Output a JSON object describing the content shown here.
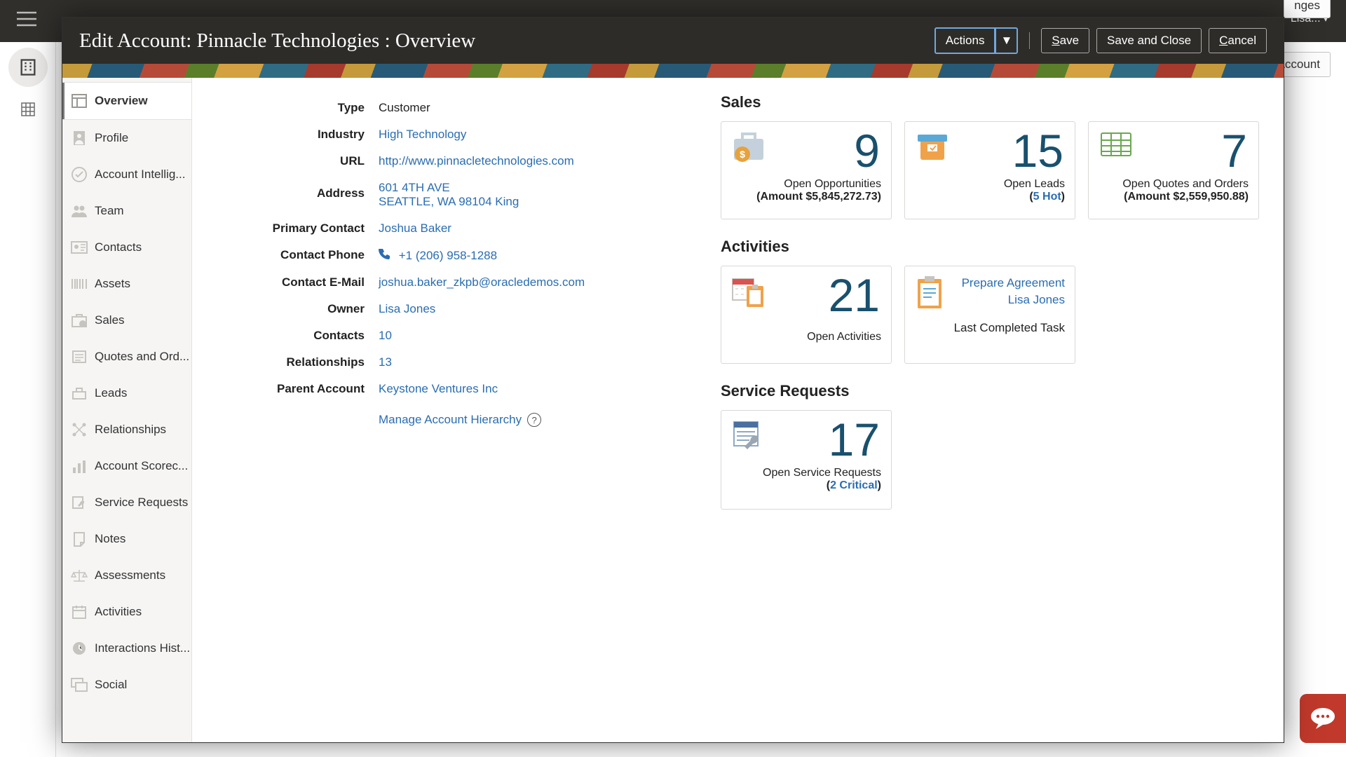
{
  "background": {
    "user_label": "Lisa...",
    "btn_account": "Account",
    "btn_nges": "nges"
  },
  "header": {
    "title": "Edit Account: Pinnacle Technologies : Overview",
    "actions": {
      "actions": "Actions",
      "save": "Save",
      "save_close": "Save and Close",
      "cancel": "Cancel",
      "save_u": "S",
      "save_rest": "ave",
      "cancel_u": "C",
      "cancel_rest": "ancel"
    }
  },
  "sidebar": {
    "items": [
      {
        "label": "Overview"
      },
      {
        "label": "Profile"
      },
      {
        "label": "Account Intellig..."
      },
      {
        "label": "Team"
      },
      {
        "label": "Contacts"
      },
      {
        "label": "Assets"
      },
      {
        "label": "Sales"
      },
      {
        "label": "Quotes and Ord..."
      },
      {
        "label": "Leads"
      },
      {
        "label": "Relationships"
      },
      {
        "label": "Account Scorec..."
      },
      {
        "label": "Service Requests"
      },
      {
        "label": "Notes"
      },
      {
        "label": "Assessments"
      },
      {
        "label": "Activities"
      },
      {
        "label": "Interactions Hist..."
      },
      {
        "label": "Social"
      }
    ]
  },
  "details": {
    "type": {
      "label": "Type",
      "value": "Customer"
    },
    "industry": {
      "label": "Industry",
      "value": "High Technology"
    },
    "url": {
      "label": "URL",
      "value": "http://www.pinnacletechnologies.com"
    },
    "address": {
      "label": "Address",
      "line1": "601 4TH AVE",
      "line2": "SEATTLE, WA 98104 King"
    },
    "primary_contact": {
      "label": "Primary Contact",
      "value": "Joshua Baker"
    },
    "contact_phone": {
      "label": "Contact Phone",
      "value": "+1 (206) 958-1288"
    },
    "contact_email": {
      "label": "Contact E-Mail",
      "value": "joshua.baker_zkpb@oracledemos.com"
    },
    "owner": {
      "label": "Owner",
      "value": "Lisa Jones"
    },
    "contacts": {
      "label": "Contacts",
      "value": "10"
    },
    "relationships": {
      "label": "Relationships",
      "value": "13"
    },
    "parent_account": {
      "label": "Parent Account",
      "value": "Keystone Ventures Inc"
    },
    "manage_hierarchy": "Manage Account Hierarchy"
  },
  "sales": {
    "title": "Sales",
    "open_opps": {
      "num": "9",
      "caption": "Open Opportunities",
      "sub": "(Amount $5,845,272.73)"
    },
    "open_leads": {
      "num": "15",
      "caption": "Open Leads",
      "hot_n": "5",
      "hot_label": " Hot"
    },
    "open_quotes": {
      "num": "7",
      "caption": "Open Quotes and Orders",
      "sub": "(Amount $2,559,950.88)"
    }
  },
  "activities": {
    "title": "Activities",
    "open_activities": {
      "num": "21",
      "caption": "Open Activities"
    },
    "last_task": {
      "link": "Prepare Agreement",
      "owner": "Lisa Jones",
      "label": "Last Completed Task"
    }
  },
  "service": {
    "title": "Service Requests",
    "open_sr": {
      "num": "17",
      "caption": "Open Service Requests",
      "crit_n": "2",
      "crit_label": " Critical"
    }
  }
}
